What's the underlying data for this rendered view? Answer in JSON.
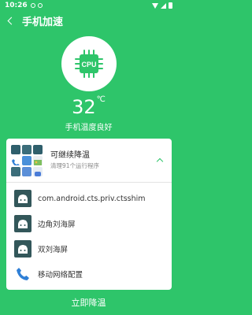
{
  "status_bar": {
    "time": "10:26"
  },
  "app_bar": {
    "title": "手机加速"
  },
  "hero": {
    "chip_label": "CPU"
  },
  "temperature": {
    "value": "32",
    "unit": "℃",
    "status": "手机温度良好"
  },
  "card": {
    "title": "可继续降温",
    "subtitle": "清理91个运行程序",
    "apps": [
      {
        "label": "com.android.cts.priv.ctsshim",
        "icon": "android-icon"
      },
      {
        "label": "边角刘海屏",
        "icon": "android-icon"
      },
      {
        "label": "双刘海屏",
        "icon": "android-icon"
      },
      {
        "label": "移动网络配置",
        "icon": "phone-icon"
      }
    ]
  },
  "action": {
    "label": "立即降温"
  },
  "colors": {
    "accent": "#2ec56a",
    "android_icon_bg": "#33575a",
    "phone_icon": "#2f7fd6"
  }
}
